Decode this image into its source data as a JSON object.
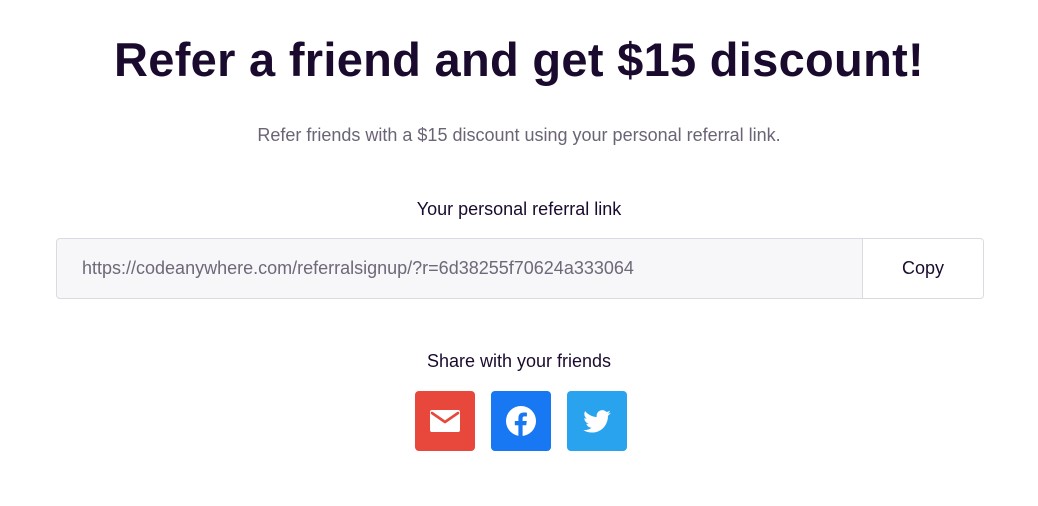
{
  "header": {
    "title": "Refer a friend and get $15 discount!",
    "subtitle": "Refer friends with a $15 discount using your personal referral link."
  },
  "referral": {
    "label": "Your personal referral link",
    "link": "https://codeanywhere.com/referralsignup/?r=6d38255f70624a333064",
    "copy_label": "Copy"
  },
  "share": {
    "label": "Share with your friends",
    "buttons": [
      {
        "icon": "email-icon",
        "color": "#e8473b"
      },
      {
        "icon": "facebook-icon",
        "color": "#1877f2"
      },
      {
        "icon": "twitter-icon",
        "color": "#2aa3ef"
      }
    ]
  }
}
